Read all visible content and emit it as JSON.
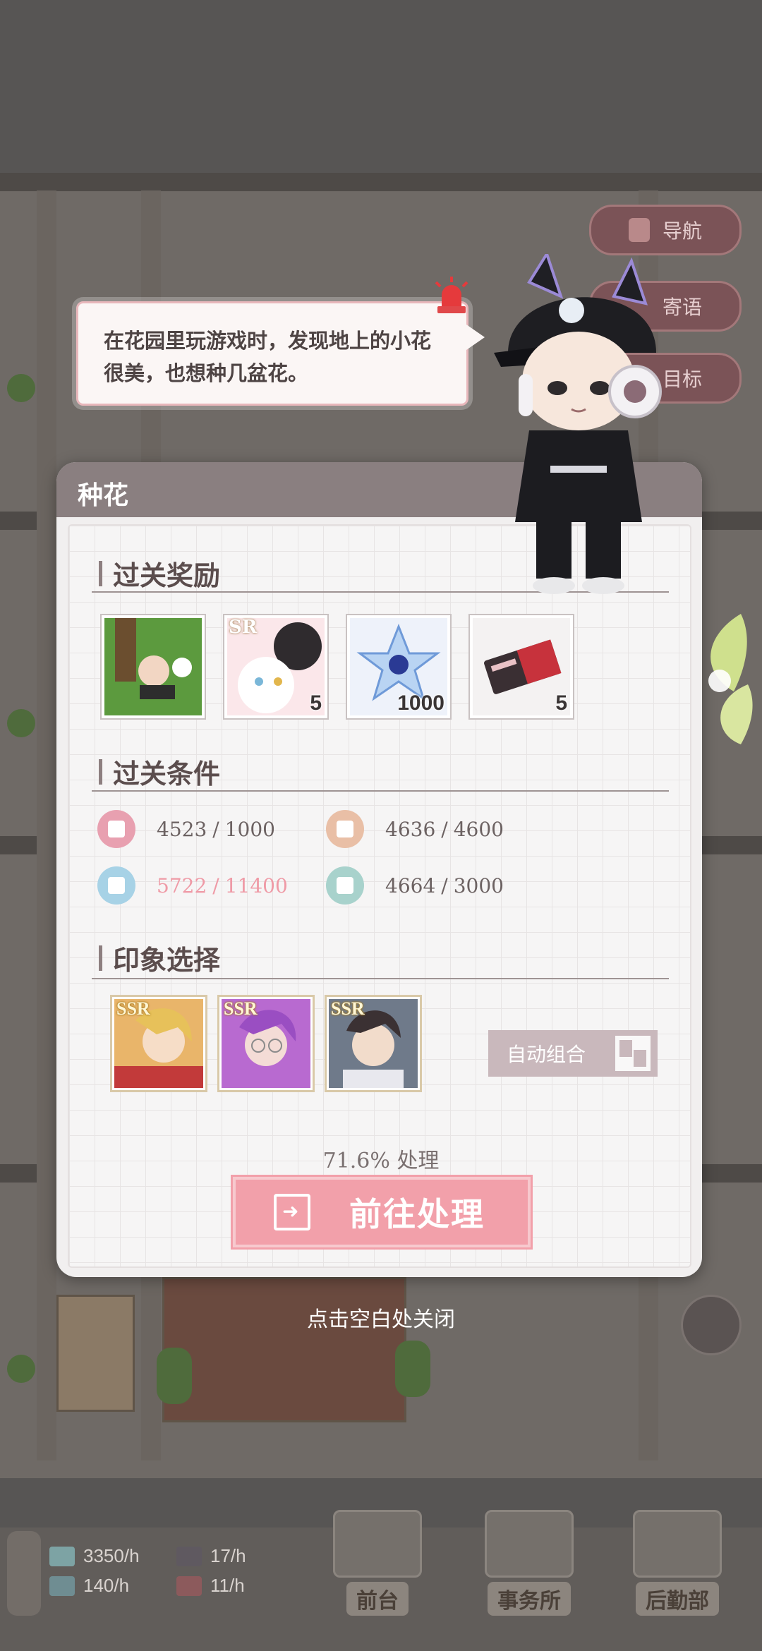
{
  "dialog": {
    "title": "种花",
    "rewards_title": "过关奖励",
    "rewards": [
      {
        "name": "chibi-card",
        "count": ""
      },
      {
        "name": "sr-cat-card",
        "count": "5",
        "badge": "SR"
      },
      {
        "name": "crystal",
        "count": "1000"
      },
      {
        "name": "ticket",
        "count": "5"
      }
    ],
    "conditions_title": "过关条件",
    "conditions": [
      {
        "icon": "dumbbell-icon",
        "current": "4523",
        "sep": "/",
        "required": "1000",
        "color": "#e8a0b0",
        "met": true
      },
      {
        "icon": "person-icon",
        "current": "4636",
        "sep": "/",
        "required": "4600",
        "color": "#e9bfa6",
        "met": true
      },
      {
        "icon": "graduation-cap-icon",
        "current": "5722",
        "sep": "/",
        "required": "11400",
        "color": "#a7d2e6",
        "met": false
      },
      {
        "icon": "flower-icon",
        "current": "4664",
        "sep": "/",
        "required": "3000",
        "color": "#a8d2cc",
        "met": true
      }
    ],
    "impression_title": "印象选择",
    "cards": [
      {
        "rarity": "SSR",
        "name": "blonde-character-card"
      },
      {
        "rarity": "SSR",
        "name": "purple-hair-character-card"
      },
      {
        "rarity": "SSR",
        "name": "dark-hair-character-card"
      }
    ],
    "auto_button": "自动组合",
    "progress": "71.6% 处理",
    "go_button": "前往处理"
  },
  "bubble": {
    "text": "在花园里玩游戏时，发现地上的小花很美，也想种几盆花。"
  },
  "close_hint": "点击空白处关闭",
  "side_buttons": [
    {
      "label": "导航",
      "icon": "map-pin-icon"
    },
    {
      "label": "寄语",
      "icon": ""
    },
    {
      "label": "目标",
      "icon": ""
    }
  ],
  "resources": [
    {
      "icon": "money-icon",
      "value": "3350/h"
    },
    {
      "icon": "book-icon",
      "value": "140/h"
    },
    {
      "icon": "grad-icon",
      "value": "17/h"
    },
    {
      "icon": "gift-icon",
      "value": "11/h"
    }
  ],
  "bottom_tabs": [
    {
      "label": "前台"
    },
    {
      "label": "事务所"
    },
    {
      "label": "后勤部"
    }
  ],
  "colors": {
    "accent_pink": "#f2a0aa",
    "unmet_text": "#ef9aa6",
    "header": "#8a7f80"
  }
}
